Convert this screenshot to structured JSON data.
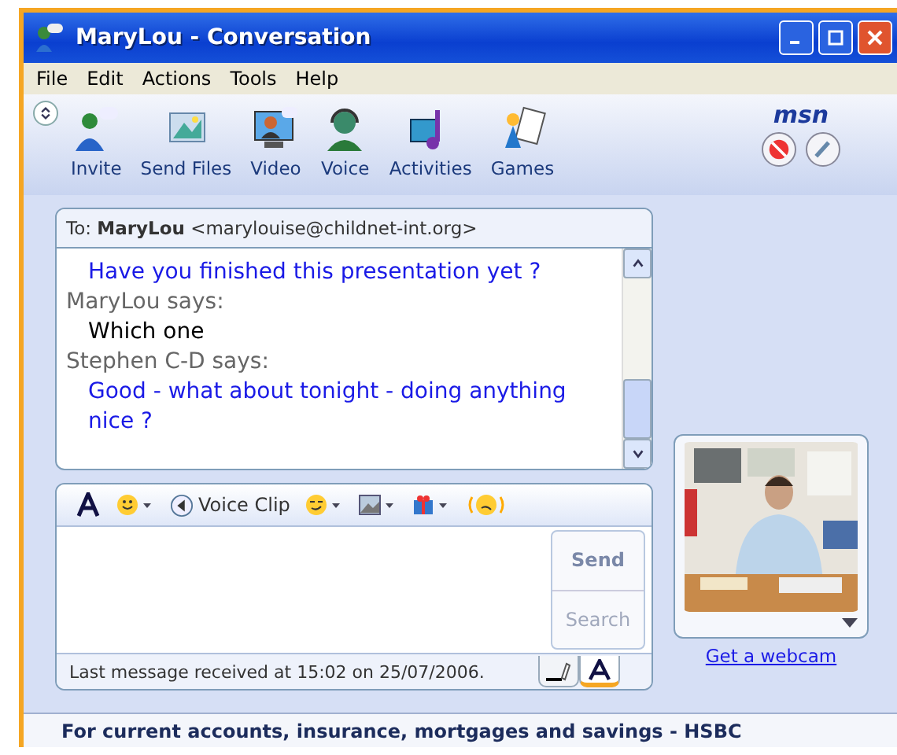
{
  "window": {
    "title": "MaryLou - Conversation"
  },
  "menu": [
    "File",
    "Edit",
    "Actions",
    "Tools",
    "Help"
  ],
  "toolbar": [
    {
      "label": "Invite"
    },
    {
      "label": "Send Files"
    },
    {
      "label": "Video"
    },
    {
      "label": "Voice"
    },
    {
      "label": "Activities"
    },
    {
      "label": "Games"
    }
  ],
  "brand": "msn",
  "to": {
    "prefix": "To:",
    "name": "MaryLou",
    "address": "<marylouise@childnet-int.org>"
  },
  "messages": [
    {
      "kind": "text",
      "own": true,
      "text": "Have you finished this presentation yet ?"
    },
    {
      "kind": "sender",
      "text": "MaryLou says:"
    },
    {
      "kind": "text",
      "own": false,
      "text": "Which one"
    },
    {
      "kind": "sender",
      "text": "Stephen C-D says:"
    },
    {
      "kind": "text",
      "own": true,
      "text": "Good - what about tonight - doing anything nice ?"
    }
  ],
  "compose_toolbar": {
    "voice_clip": "Voice Clip"
  },
  "buttons": {
    "send": "Send",
    "search": "Search"
  },
  "status": "Last message received at 15:02 on 25/07/2006.",
  "webcam": {
    "link": "Get a webcam"
  },
  "ad": "For current accounts, insurance, mortgages and savings - HSBC"
}
